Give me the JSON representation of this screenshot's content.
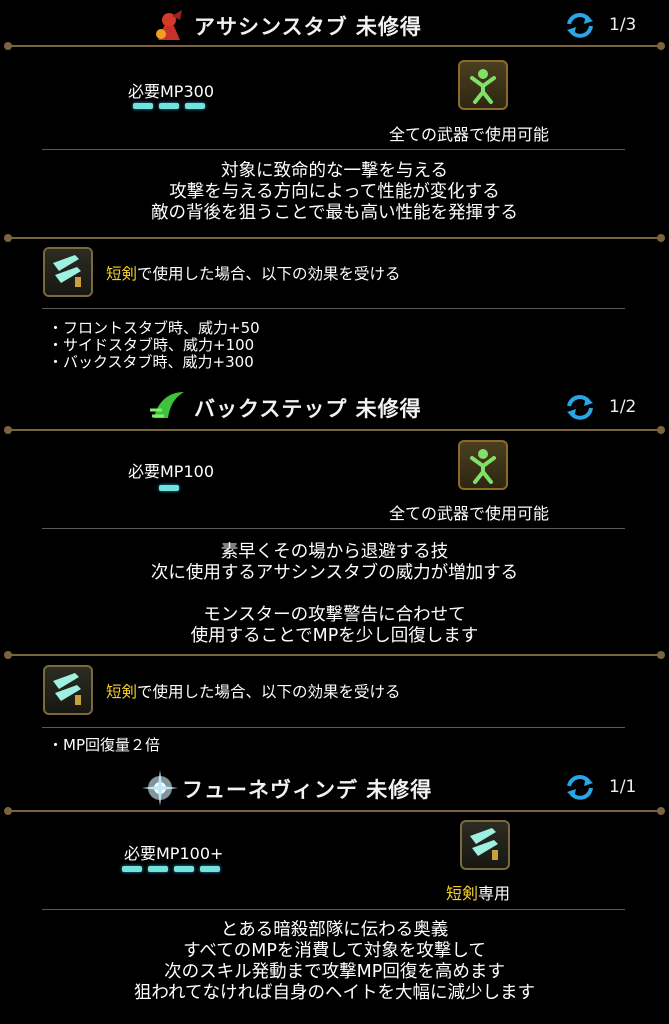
{
  "skills": [
    {
      "title": "アサシンスタブ 未修得",
      "counter": "1/3",
      "mp_label": "必要MP300",
      "mp_pips": 3,
      "weapon_note": "全ての武器で使用可能",
      "description": [
        "対象に致命的な一撃を与える",
        "攻撃を与える方向によって性能が変化する",
        "敵の背後を狙うことで最も高い性能を発揮する"
      ],
      "dagger_word": "短剣",
      "dagger_line": "で使用した場合、以下の効果を受ける",
      "bullets": [
        "・フロントスタブ時、威力+50",
        "・サイドスタブ時、威力+100",
        "・バックスタブ時、威力+300"
      ]
    },
    {
      "title": "バックステップ 未修得",
      "counter": "1/2",
      "mp_label": "必要MP100",
      "mp_pips": 1,
      "weapon_note": "全ての武器で使用可能",
      "description": [
        "素早くその場から退避する技",
        "次に使用するアサシンスタブの威力が増加する",
        "",
        "モンスターの攻撃警告に合わせて",
        "使用することでMPを少し回復します"
      ],
      "dagger_word": "短剣",
      "dagger_line": "で使用した場合、以下の効果を受ける",
      "bullets": [
        "・MP回復量２倍"
      ]
    },
    {
      "title": "フューネヴィンデ 未修得",
      "counter": "1/1",
      "mp_label": "必要MP100+",
      "mp_pips": 4,
      "weapon_word": "短剣",
      "weapon_suffix": "専用",
      "description": [
        "とある暗殺部隊に伝わる奥義",
        "すべてのMPを消費して対象を攻撃して",
        "次のスキル発動まで攻撃MP回復を高めます",
        "狙われてなければ自身のヘイトを大幅に減少します"
      ]
    }
  ],
  "colors": {
    "pip": "#6fe3dc",
    "highlight": "#f5d02a",
    "frame": "#8a6a2a"
  },
  "icons": [
    "assassin-stab-icon",
    "backstep-icon",
    "funewinde-icon",
    "refresh-icon",
    "all-weapons-icon",
    "dagger-icon"
  ]
}
